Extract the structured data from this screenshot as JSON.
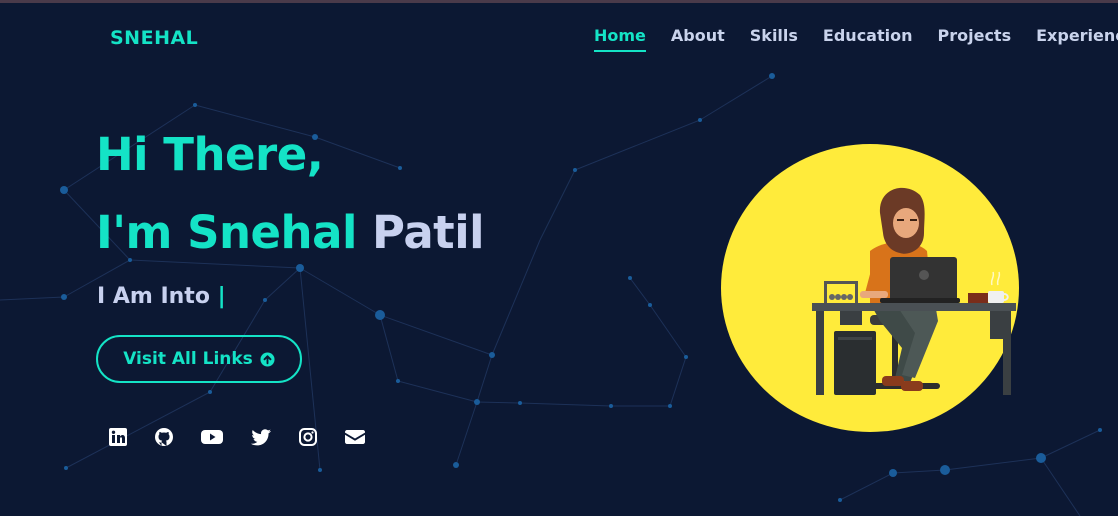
{
  "brand": "SNEHAL",
  "nav": {
    "home": "Home",
    "about": "About",
    "skills": "Skills",
    "education": "Education",
    "projects": "Projects",
    "experience": "Experience"
  },
  "hero": {
    "line1": "Hi There,",
    "line2_first": "I'm Snehal",
    "line2_last": "Patil",
    "into": "I Am Into",
    "cursor": "|",
    "button_label": "Visit All Links"
  },
  "socials": [
    "linkedin-icon",
    "github-icon",
    "youtube-icon",
    "twitter-icon",
    "instagram-icon",
    "email-icon"
  ],
  "colors": {
    "accent": "#14e3c6",
    "background": "#0c1833",
    "illustration_bg": "#ffeb3b"
  }
}
